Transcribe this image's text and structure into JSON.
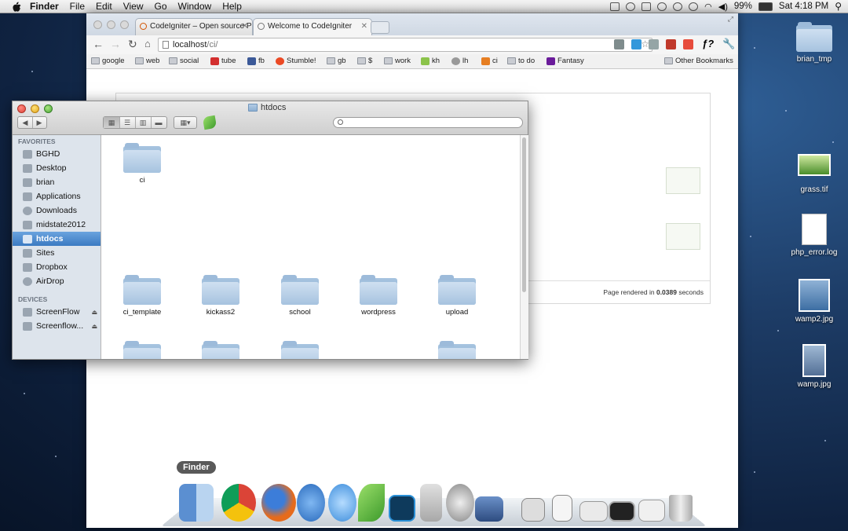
{
  "menubar": {
    "app_name": "Finder",
    "items": [
      "File",
      "Edit",
      "View",
      "Go",
      "Window",
      "Help"
    ],
    "battery": "99%",
    "clock": "Sat 4:18 PM"
  },
  "browser": {
    "tabs": [
      {
        "title": "CodeIgniter – Open source P"
      },
      {
        "title": "Welcome to CodeIgniter"
      }
    ],
    "url_host": "localhost",
    "url_path": "/ci/",
    "bookmarks": [
      "google",
      "web",
      "social",
      "tube",
      "fb",
      "Stumble!",
      "gb",
      "$",
      "work",
      "kh",
      "lh",
      "ci",
      "to do",
      "Fantasy"
    ],
    "other_bookmarks": "Other Bookmarks",
    "footer_prefix": "Page rendered in ",
    "footer_time": "0.0389",
    "footer_suffix": " seconds"
  },
  "finder": {
    "window_title": "htdocs",
    "favorites_header": "FAVORITES",
    "favorites": [
      "BGHD",
      "Desktop",
      "brian",
      "Applications",
      "Downloads",
      "midstate2012",
      "htdocs",
      "Sites",
      "Dropbox",
      "AirDrop"
    ],
    "selected": "htdocs",
    "devices_header": "DEVICES",
    "devices": [
      "ScreenFlow",
      "Screenflow..."
    ],
    "files": [
      "ci",
      "ci_template",
      "kickass2",
      "school",
      "wordpress",
      "upload"
    ]
  },
  "desktop": {
    "icons": [
      "brian_tmp",
      "grass.tif",
      "php_error.log",
      "wamp2.jpg",
      "wamp.jpg"
    ]
  },
  "dock": {
    "tooltip": "Finder",
    "apps": [
      "Finder",
      "Chrome",
      "Firefox",
      "iTunes",
      "Messages",
      "Coda",
      "Photoshop",
      "Utilities",
      "System Preferences",
      "Preview",
      "Applications",
      "Documents",
      "Downloads",
      "Screenshots",
      "Display",
      "Address",
      "Trash"
    ]
  },
  "colors": {
    "selection": "#3b7ac2",
    "folder": "#a6c3df",
    "desktop": "#1d3c66"
  }
}
